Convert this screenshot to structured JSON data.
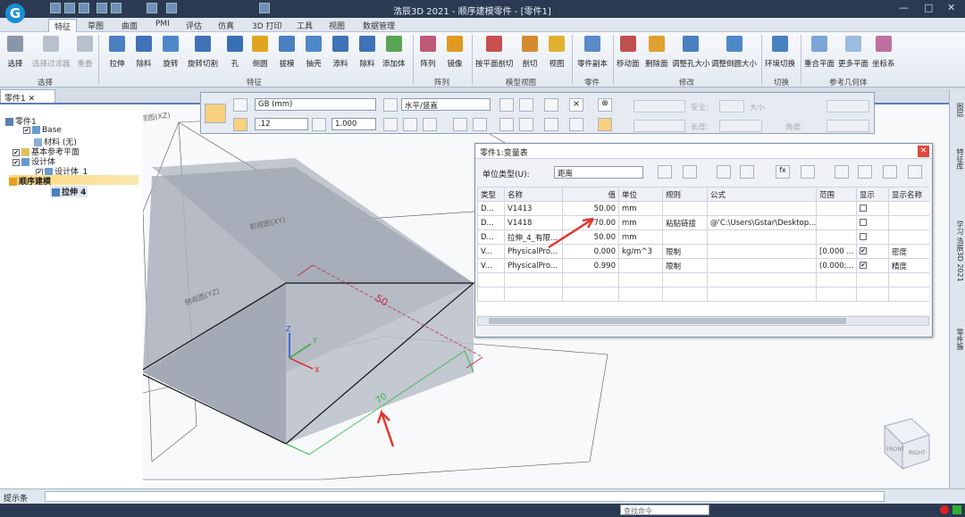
{
  "app": {
    "title": "浩辰3D 2021 - 顺序建模零件 - [零件1]"
  },
  "menu": [
    "特征",
    "草图",
    "曲面",
    "PMI",
    "评估",
    "仿真",
    "3D 打印",
    "工具",
    "视图",
    "数据管理"
  ],
  "ribbon": {
    "buttons": [
      "选择",
      "选择过滤器",
      "重叠",
      "拉伸",
      "除料",
      "旋转",
      "旋转切割",
      "孔",
      "倒圆",
      "拔模",
      "抽壳",
      "添料",
      "除料",
      "添加体",
      "阵列",
      "镜像",
      "按平面剖切",
      "剖切",
      "视图",
      "零件副本",
      "移动面",
      "删除面",
      "调整孔大小",
      "调整倒圆大小",
      "环境切换",
      "重合平面",
      "更多平面",
      "坐标系"
    ],
    "groups": [
      "选择",
      "特征",
      "阵列",
      "模型视图",
      "零件",
      "修改",
      "切换",
      "参考几何体"
    ]
  },
  "doc_tab": "零件1",
  "tree": {
    "root": "零件1",
    "items": [
      "Base",
      "材料 (无)",
      "基本参考平面",
      "设计体",
      "设计体_1",
      "顺序建模",
      "拉伸 4"
    ]
  },
  "viewport": {
    "plane_labels": [
      "俯视图(XZ)",
      "侧视图(YZ)",
      "前视图(XY)"
    ],
    "dim_top": "50",
    "dim_front": "70",
    "axis_labels": [
      "Z",
      "Y",
      "X"
    ],
    "cube_labels": [
      "FRONT",
      "RIGHT"
    ]
  },
  "sketch_toolbar": {
    "standard": "GB (mm)",
    "decimals": ".12",
    "scale": "1.000",
    "orientation": "水平/竖直",
    "labels": [
      "安全:",
      "大小",
      "长度:",
      "角度:"
    ]
  },
  "var_table": {
    "title": "零件1:变量表",
    "unit_label": "单位类型(U):",
    "unit_value": "距离",
    "columns": [
      "类型",
      "名称",
      "值",
      "单位",
      "规则",
      "公式",
      "范围",
      "显示",
      "显示名称"
    ],
    "rows": [
      [
        "D...",
        "V1413",
        "50.00",
        "mm",
        "",
        "",
        "",
        "",
        ""
      ],
      [
        "D...",
        "V1418",
        "70.00",
        "mm",
        "粘贴链接",
        "@'C:\\Users\\Gstar\\Desktop...",
        "",
        "",
        ""
      ],
      [
        "D...",
        "拉伸_4_有限...",
        "50.00",
        "mm",
        "",
        "",
        "",
        "",
        ""
      ],
      [
        "V...",
        "PhysicalPro...",
        "0.000",
        "kg/m^3",
        "限制",
        "",
        "[0.000 ...",
        "✔",
        "密度"
      ],
      [
        "V...",
        "PhysicalPro...",
        "0.990",
        "",
        "限制",
        "",
        "(0.000;...",
        "✔",
        "精度"
      ]
    ]
  },
  "right_tabs": [
    "图层",
    "特征库",
    "学习 浩辰3D 2021",
    "零件簇"
  ],
  "status": {
    "prompt": "提示条",
    "cmd_placeholder": "查找命令"
  },
  "colors": {
    "titlebar": "#2b3a52",
    "accent": "#5a7fb8",
    "dim_red": "#c0304a",
    "dim_green": "#2fb84a",
    "arrow": "#e2372e"
  }
}
